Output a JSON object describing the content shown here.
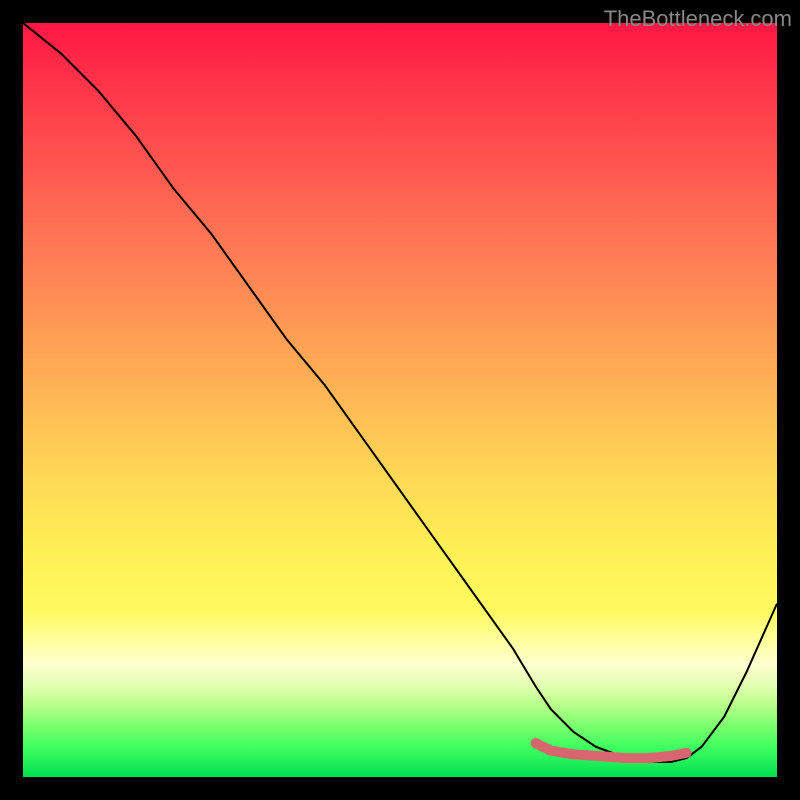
{
  "watermark": "TheBottleneck.com",
  "chart_data": {
    "type": "line",
    "title": "",
    "xlabel": "",
    "ylabel": "",
    "xlim": [
      0,
      100
    ],
    "ylim": [
      0,
      100
    ],
    "series": [
      {
        "name": "bottleneck-curve",
        "color": "#000000",
        "width": 2,
        "x": [
          0,
          5,
          10,
          15,
          20,
          25,
          30,
          35,
          40,
          45,
          50,
          55,
          60,
          65,
          68,
          70,
          73,
          76,
          80,
          83,
          86,
          88,
          90,
          93,
          96,
          100
        ],
        "y": [
          100,
          96,
          91,
          85,
          78,
          72,
          65,
          58,
          52,
          45,
          38,
          31,
          24,
          17,
          12,
          9,
          6,
          4,
          2.5,
          2,
          2,
          2.5,
          4,
          8,
          14,
          23
        ]
      },
      {
        "name": "optimal-range-marker",
        "color": "#d9666f",
        "width": 10,
        "x": [
          68,
          70,
          73,
          76,
          80,
          83,
          86,
          88
        ],
        "y": [
          4.5,
          3.5,
          3,
          2.8,
          2.5,
          2.5,
          2.8,
          3.2
        ]
      }
    ],
    "gradient_background": {
      "top_color": "#ff1744",
      "bottom_color": "#00e050",
      "description": "vertical gradient red to green representing bottleneck severity"
    }
  }
}
